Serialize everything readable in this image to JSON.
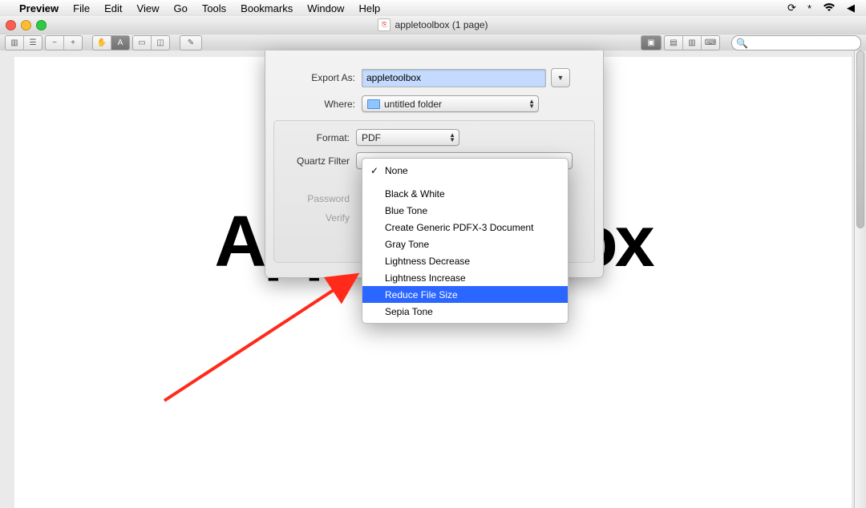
{
  "menubar": {
    "app": "Preview",
    "items": [
      "File",
      "Edit",
      "View",
      "Go",
      "Tools",
      "Bookmarks",
      "Window",
      "Help"
    ]
  },
  "window": {
    "title": "appletoolbox (1 page)"
  },
  "toolbar": {
    "search_placeholder": ""
  },
  "document": {
    "bg_text": "AppleToolbox"
  },
  "sheet": {
    "export_label": "Export As:",
    "export_value": "appletoolbox",
    "where_label": "Where:",
    "where_value": "untitled folder",
    "format_label": "Format:",
    "format_value": "PDF",
    "filter_label": "Quartz Filter",
    "password_label": "Password",
    "verify_label": "Verify"
  },
  "dropdown": {
    "selected": "None",
    "highlighted": "Reduce File Size",
    "items": [
      "None",
      "Black & White",
      "Blue Tone",
      "Create Generic PDFX-3 Document",
      "Gray Tone",
      "Lightness Decrease",
      "Lightness Increase",
      "Reduce File Size",
      "Sepia Tone"
    ]
  }
}
